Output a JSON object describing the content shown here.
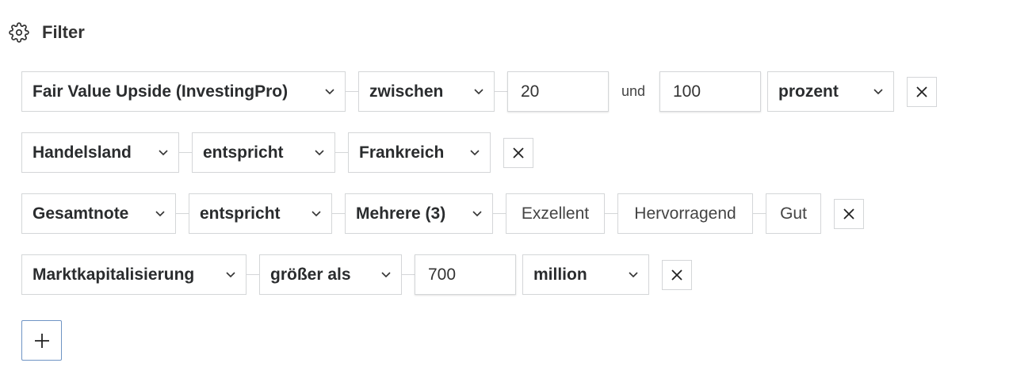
{
  "header": {
    "title": "Filter",
    "icon": "gear-icon"
  },
  "rows": [
    {
      "field": "Fair Value Upside (InvestingPro)",
      "operator": "zwischen",
      "value_from": "20",
      "joiner": "und",
      "value_to": "100",
      "unit": "prozent"
    },
    {
      "field": "Handelsland",
      "operator": "entspricht",
      "value": "Frankreich"
    },
    {
      "field": "Gesamtnote",
      "operator": "entspricht",
      "value": "Mehrere (3)",
      "tags": [
        "Exzellent",
        "Hervorragend",
        "Gut"
      ]
    },
    {
      "field": "Marktkapitalisierung",
      "operator": "größer als",
      "value": "700",
      "unit": "million"
    }
  ],
  "add_button_icon": "plus-icon",
  "colors": {
    "border": "#d4d6d8",
    "add_border": "#6f94c4",
    "text": "#2a2c2e"
  }
}
